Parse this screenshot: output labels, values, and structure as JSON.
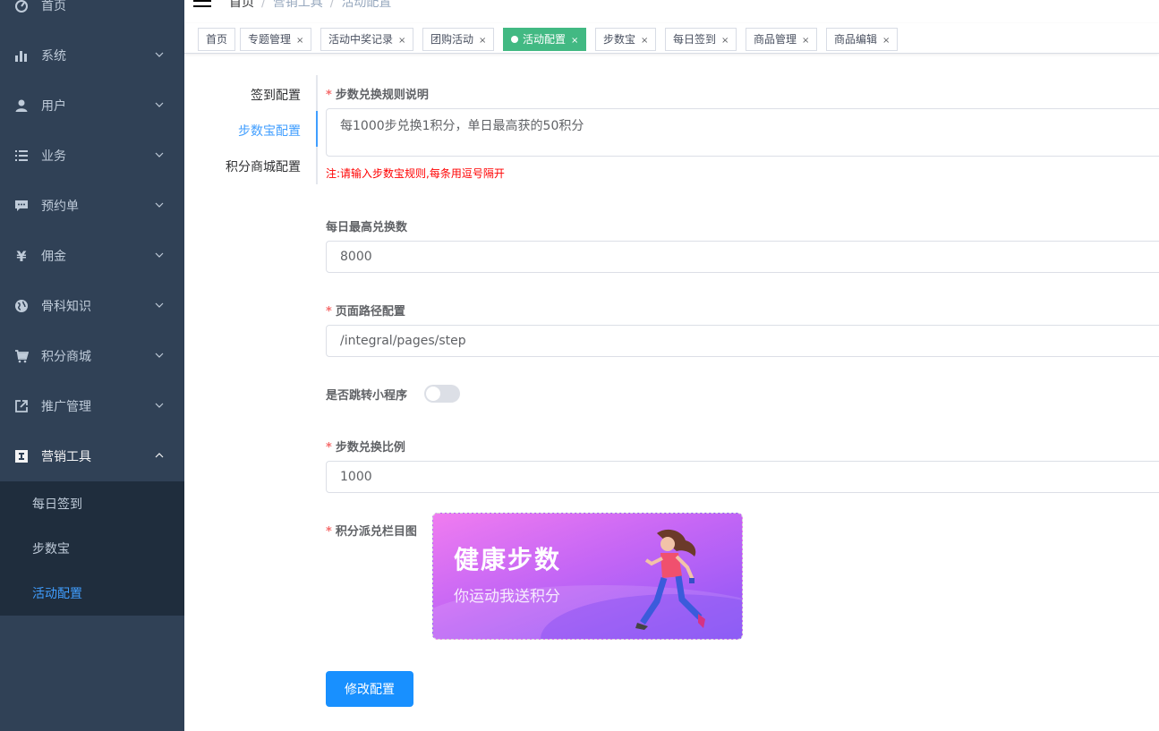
{
  "sidebar": {
    "items": [
      {
        "label": "首页",
        "icon": "dashboard-icon"
      },
      {
        "label": "系统",
        "icon": "bar-chart-icon"
      },
      {
        "label": "用户",
        "icon": "user-icon"
      },
      {
        "label": "业务",
        "icon": "list-icon"
      },
      {
        "label": "预约单",
        "icon": "chat-icon"
      },
      {
        "label": "佣金",
        "icon": "yen-icon"
      },
      {
        "label": "骨科知识",
        "icon": "globe-icon"
      },
      {
        "label": "积分商城",
        "icon": "cart-icon"
      },
      {
        "label": "推广管理",
        "icon": "share-icon"
      },
      {
        "label": "营销工具",
        "icon": "tool-icon"
      }
    ],
    "submenu": [
      "每日签到",
      "步数宝",
      "活动配置"
    ]
  },
  "breadcrumb": [
    "首页",
    "营销工具",
    "活动配置"
  ],
  "tags": [
    {
      "label": "首页"
    },
    {
      "label": "专题管理"
    },
    {
      "label": "活动中奖记录"
    },
    {
      "label": "团购活动"
    },
    {
      "label": "活动配置"
    },
    {
      "label": "步数宝"
    },
    {
      "label": "每日签到"
    },
    {
      "label": "商品管理"
    },
    {
      "label": "商品编辑"
    }
  ],
  "tag_close": "×",
  "vtabs": [
    "签到配置",
    "步数宝配置",
    "积分商城配置"
  ],
  "form": {
    "rule_label": "步数兑换规则说明",
    "rule_value": "每1000步兑换1积分，单日最高获的50积分",
    "rule_hint": "注:请输入步数宝规则,每条用逗号隔开",
    "max_label": "每日最高兑换数",
    "max_value": "8000",
    "path_label": "页面路径配置",
    "path_value": "/integral/pages/step",
    "jump_label": "是否跳转小程序",
    "ratio_label": "步数兑换比例",
    "ratio_value": "1000",
    "banner_label": "积分派兑栏目图",
    "banner_title": "健康步数",
    "banner_sub": "你运动我送积分",
    "submit": "修改配置",
    "required_mark": "*",
    "jump_enabled": false
  },
  "colors": {
    "sidebar": "#304156",
    "submenu": "#1f2d3d",
    "accent": "#409eff",
    "active_tag": "#42b983",
    "button": "#1890ff"
  }
}
